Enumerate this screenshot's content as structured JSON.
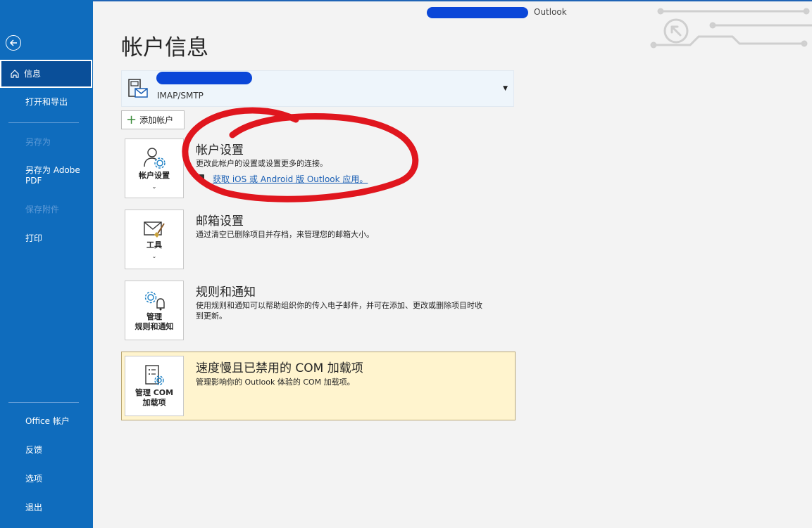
{
  "window": {
    "app_name": "Outlook"
  },
  "page": {
    "title": "帐户信息"
  },
  "sidebar": {
    "items": [
      {
        "label": "信息",
        "active": true
      },
      {
        "label": "打开和导出"
      },
      {
        "label": "另存为",
        "disabled": true
      },
      {
        "label": "另存为 Adobe PDF"
      },
      {
        "label": "保存附件",
        "disabled": true
      },
      {
        "label": "打印"
      },
      {
        "label": "Office 帐户"
      },
      {
        "label": "反馈"
      },
      {
        "label": "选项"
      },
      {
        "label": "退出"
      }
    ]
  },
  "account": {
    "type": "IMAP/SMTP",
    "add_label": "添加帐户"
  },
  "sections": {
    "account_settings": {
      "tile_label": "帐户设置",
      "title": "帐户设置",
      "desc": "更改此帐户的设置或设置更多的连接。",
      "link": "获取 iOS 或 Android 版 Outlook 应用。"
    },
    "mailbox": {
      "tile_label": "工具",
      "title": "邮箱设置",
      "desc": "通过清空已删除项目并存档，来管理您的邮箱大小。"
    },
    "rules": {
      "tile_label_1": "管理",
      "tile_label_2": "规则和通知",
      "title": "规则和通知",
      "desc_1": "使用规则和通知可以帮助组织你的传入电子邮件，并可在添加、更改或删除项目时收",
      "desc_2": "到更新。"
    },
    "com": {
      "tile_label_1": "管理 COM",
      "tile_label_2": "加载项",
      "title": "速度慢且已禁用的 COM 加载项",
      "desc": "管理影响你的 Outlook 体验的 COM 加载项。"
    }
  },
  "colors": {
    "sidebar": "#0f6cbd",
    "accent_link": "#1a5fb4",
    "com_panel": "#fff4ce",
    "annotation": "#e0161e"
  }
}
